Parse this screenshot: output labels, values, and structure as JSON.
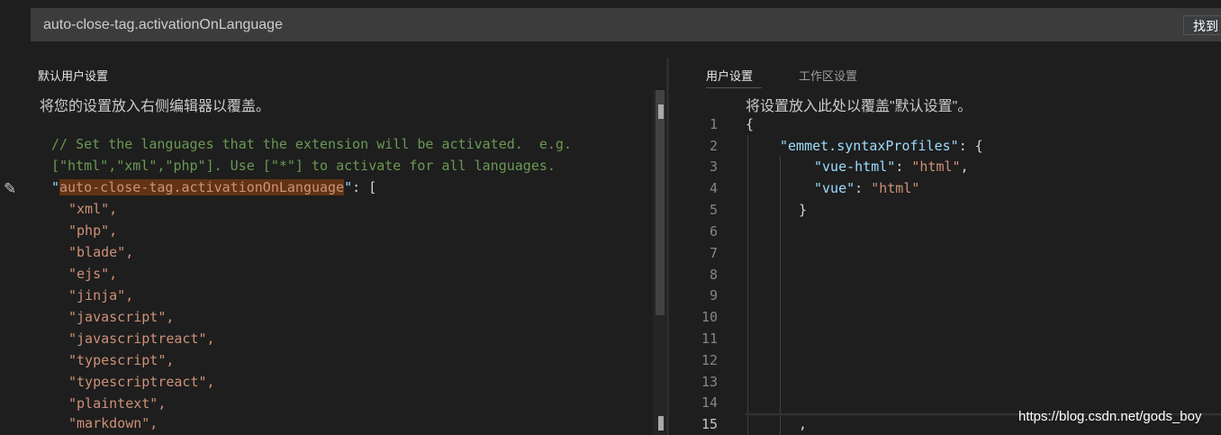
{
  "search": {
    "value": "auto-close-tag.activationOnLanguage",
    "find_button": "找到"
  },
  "left_pane": {
    "title": "默认用户设置",
    "hint": "将您的设置放入右侧编辑器以覆盖。",
    "comment_line1": "// Set the languages that the extension will be activated.  e.g.",
    "comment_line2": "[\"html\",\"xml\",\"php\"]. Use [\"*\"] to activate for all languages.",
    "setting_key": "auto-close-tag.activationOnLanguage",
    "values": [
      "\"xml\",",
      "\"php\",",
      "\"blade\",",
      "\"ejs\",",
      "\"jinja\",",
      "\"javascript\",",
      "\"javascriptreact\",",
      "\"typescript\",",
      "\"typescriptreact\",",
      "\"plaintext\",",
      "\"markdown\","
    ]
  },
  "right_pane": {
    "tabs": [
      {
        "label": "用户设置",
        "active": true
      },
      {
        "label": "工作区设置",
        "active": false
      }
    ],
    "hint": "将设置放入此处以覆盖\"默认设置\"。",
    "line_numbers": [
      "1",
      "2",
      "3",
      "4",
      "5",
      "6",
      "7",
      "8",
      "9",
      "10",
      "11",
      "12",
      "13",
      "14",
      "15"
    ],
    "line1": "{",
    "line2_key": "\"emmet.syntaxProfiles\"",
    "line2_rest": ": {",
    "line3_key": "\"vue-html\"",
    "line3_val": "\"html\"",
    "line4_key": "\"vue\"",
    "line4_val": "\"html\"",
    "line5": "}",
    "line15": ","
  },
  "watermark": "https://blog.csdn.net/gods_boy",
  "colors": {
    "background": "#1e1e1e",
    "comment": "#6a9955",
    "string": "#ce9178",
    "key": "#9cdcfe",
    "highlight": "#613315"
  }
}
